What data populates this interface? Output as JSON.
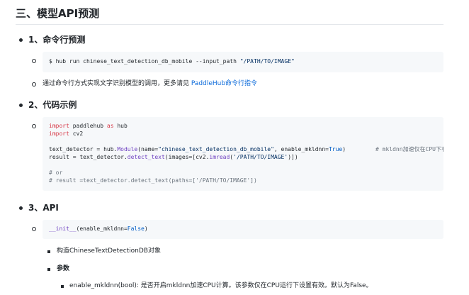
{
  "heading": "三、模型API预测",
  "sections": [
    {
      "title": "1、命令行预测"
    },
    {
      "title": "2、代码示例"
    },
    {
      "title": "3、API"
    }
  ],
  "cli": {
    "prompt": "$ ",
    "command": "hub run chinese_text_detection_db_mobile --input_path ",
    "path": "\"/PATH/TO/IMAGE\"",
    "note_prefix": "通过命令行方式实现文字识别模型的调用，更多请见 ",
    "note_link": "PaddleHub命令行指令"
  },
  "code_example": {
    "line1_kw1": "import",
    "line1_rest": " paddlehub ",
    "line1_kw2": "as",
    "line1_tail": " hub",
    "line2_kw": "import",
    "line2_rest": " cv2",
    "line4_a": "text_detector = hub.",
    "line4_fn": "Module",
    "line4_b": "(name=",
    "line4_str": "\"chinese_text_detection_db_mobile\"",
    "line4_c": ", enable_mkldnn=",
    "line4_true": "True",
    "line4_c2": ")",
    "line4_cmt": "# mkldnn加速仅在CPU下有效",
    "line5_a": "result = text_detector.",
    "line5_fn": "detect_text",
    "line5_b": "(images=[cv2.",
    "line5_fn2": "imread",
    "line5_c": "(",
    "line5_str": "'/PATH/TO/IMAGE'",
    "line5_d": ")])",
    "line7_cmt": "# or",
    "line8_cmt": "# result =text_detector.detect_text(paths=['/PATH/TO/IMAGE'])"
  },
  "api": {
    "sig_fn": "__init__",
    "sig_a": "(enable_mkldnn=",
    "sig_false": "False",
    "sig_b": ")",
    "item1": "构造ChineseTextDetectionDB对象",
    "item2": "参数",
    "param1": "enable_mkldnn(bool): 是否开启mkldnn加速CPU计算。该参数仅在CPU运行下设置有效。默认为False。"
  }
}
